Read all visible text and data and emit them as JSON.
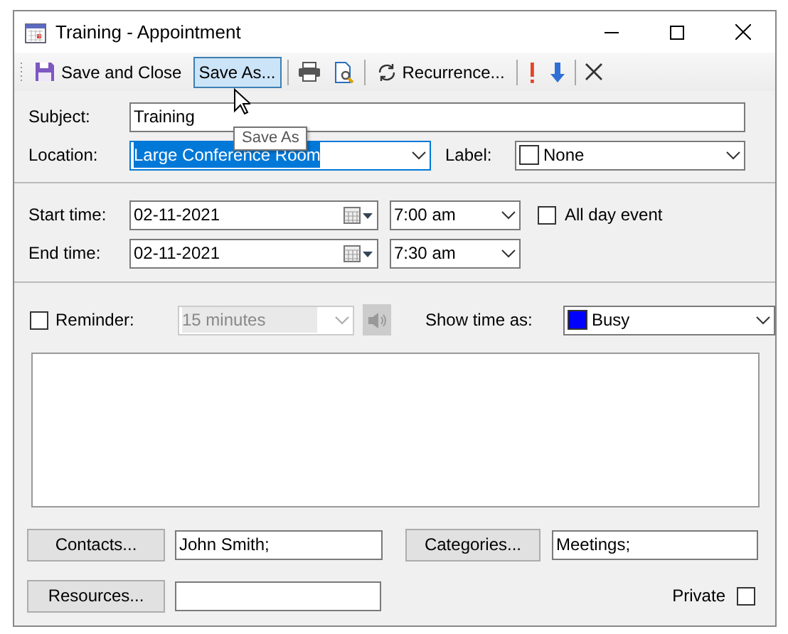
{
  "window": {
    "title": "Training - Appointment"
  },
  "toolbar": {
    "save_and_close": {
      "label": "Save and Close",
      "hovered": false
    },
    "save_as": {
      "label": "Save As...",
      "hovered": true
    },
    "recurrence": {
      "label": "Recurrence...",
      "hovered": false
    }
  },
  "tooltip": {
    "text": "Save As"
  },
  "subject": {
    "label": "Subject:",
    "value": "Training"
  },
  "location": {
    "label": "Location:",
    "value": "Large Conference Room",
    "text_selected": true
  },
  "label": {
    "label": "Label:",
    "value": "None",
    "color": "#ffffff"
  },
  "start": {
    "label": "Start time:",
    "date": "02-11-2021",
    "time": "7:00 am"
  },
  "all_day": {
    "label": "All day event",
    "checked": false
  },
  "end": {
    "label": "End time:",
    "date": "02-11-2021",
    "time": "7:30 am"
  },
  "reminder": {
    "label": "Reminder:",
    "checked": false,
    "time": "15 minutes",
    "disabled": true
  },
  "show_time_as": {
    "label": "Show time as:",
    "value": "Busy",
    "color": "#0000ff"
  },
  "contacts": {
    "button": "Contacts...",
    "value": "John Smith;"
  },
  "categories": {
    "button": "Categories...",
    "value": "Meetings;"
  },
  "resources": {
    "button": "Resources..."
  },
  "private": {
    "label": "Private",
    "checked": false
  }
}
